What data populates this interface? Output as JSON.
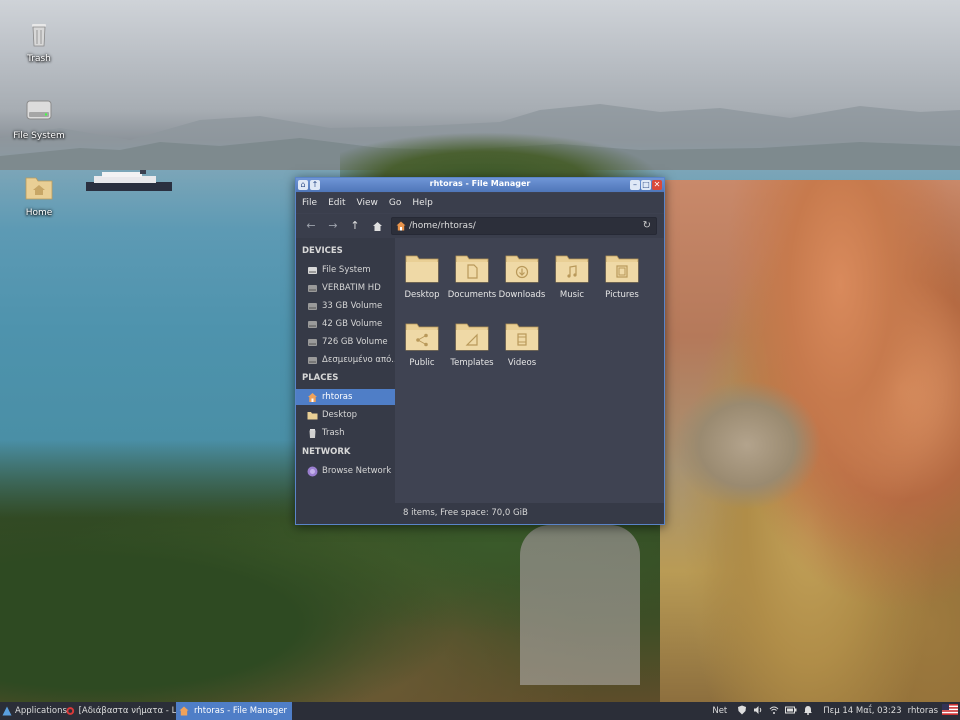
{
  "desktop": {
    "icons": [
      {
        "label": "Trash",
        "icon": "trash-icon"
      },
      {
        "label": "File System",
        "icon": "drive-icon"
      },
      {
        "label": "Home",
        "icon": "home-folder-icon"
      }
    ]
  },
  "window": {
    "title": "rhtoras - File Manager",
    "menu": [
      "File",
      "Edit",
      "View",
      "Go",
      "Help"
    ],
    "path": "/home/rhtoras/",
    "sidebar": {
      "devices_header": "DEVICES",
      "devices": [
        "File System",
        "VERBATIM HD",
        "33 GB Volume",
        "42 GB Volume",
        "726 GB Volume",
        "Δεσμευμένο από..."
      ],
      "places_header": "PLACES",
      "places": [
        "rhtoras",
        "Desktop",
        "Trash"
      ],
      "network_header": "NETWORK",
      "network": [
        "Browse Network"
      ]
    },
    "files": [
      "Desktop",
      "Documents",
      "Downloads",
      "Music",
      "Pictures",
      "Public",
      "Templates",
      "Videos"
    ],
    "status": "8 items, Free space: 70,0 GiB"
  },
  "taskbar": {
    "applications": "Applications",
    "tasks": [
      "[Αδιάβαστα νήματα - Lin...",
      "rhtoras - File Manager"
    ],
    "net": "Net",
    "clock": "Πεμ 14 Μαΐ, 03:23",
    "user": "rhtoras"
  },
  "colors": {
    "accent": "#4f7ec7",
    "folder": "#e9cf95",
    "window_bg": "#3f4352"
  }
}
